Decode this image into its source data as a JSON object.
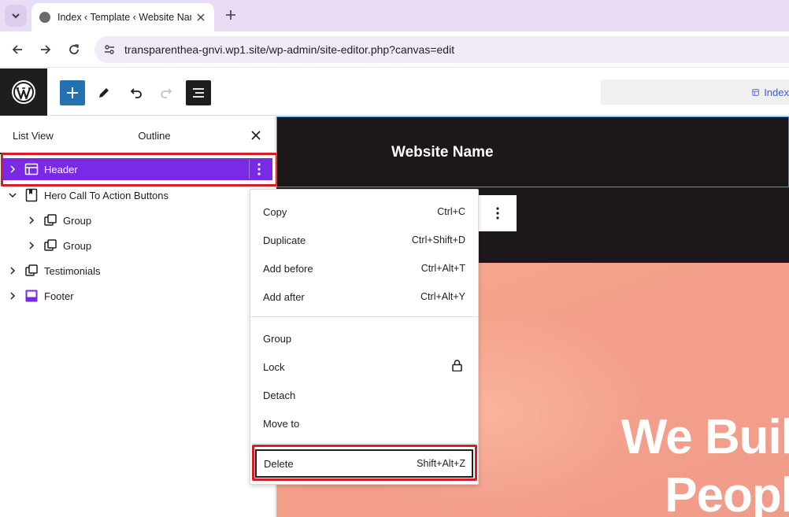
{
  "browser": {
    "tab_title": "Index ‹ Template ‹ Website Name",
    "url": "transparenthea-gnvi.wp1.site/wp-admin/site-editor.php?canvas=edit"
  },
  "toolbar": {
    "document_label": "Index"
  },
  "sidebar": {
    "tabs": [
      "List View",
      "Outline"
    ],
    "rows": [
      {
        "label": "Header"
      },
      {
        "label": "Hero Call To Action Buttons"
      },
      {
        "label": "Group"
      },
      {
        "label": "Group"
      },
      {
        "label": "Testimonials"
      },
      {
        "label": "Footer"
      }
    ]
  },
  "canvas": {
    "site_name": "Website Name",
    "hero_line1": "We Buil",
    "hero_line2": "Peopl"
  },
  "context_menu": {
    "items": [
      {
        "label": "Copy",
        "shortcut": "Ctrl+C"
      },
      {
        "label": "Duplicate",
        "shortcut": "Ctrl+Shift+D"
      },
      {
        "label": "Add before",
        "shortcut": "Ctrl+Alt+T"
      },
      {
        "label": "Add after",
        "shortcut": "Ctrl+Alt+Y"
      },
      {
        "label": "Group",
        "shortcut": ""
      },
      {
        "label": "Lock",
        "shortcut": ""
      },
      {
        "label": "Detach",
        "shortcut": ""
      },
      {
        "label": "Move to",
        "shortcut": ""
      },
      {
        "label": "Delete",
        "shortcut": "Shift+Alt+Z"
      }
    ]
  },
  "colors": {
    "accent": "#7a2ae4",
    "wp_blue": "#2271b1",
    "highlight": "#d41d27"
  }
}
